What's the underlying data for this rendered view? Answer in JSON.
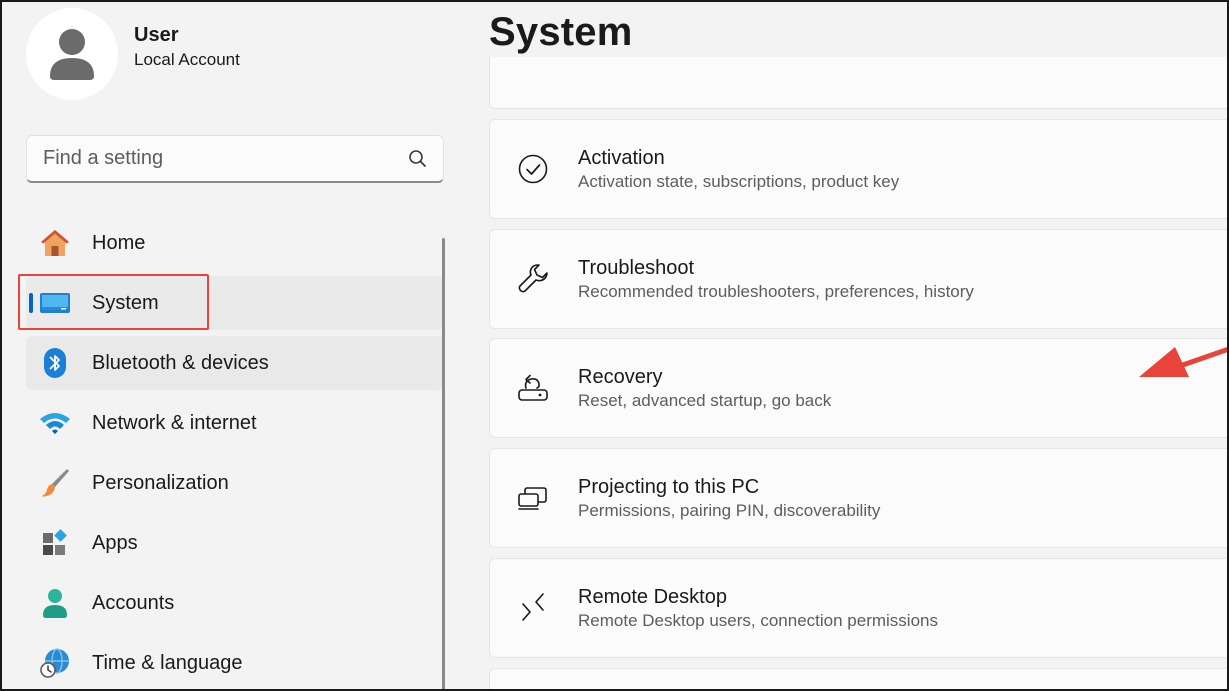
{
  "profile": {
    "name": "User",
    "type": "Local Account"
  },
  "search": {
    "placeholder": "Find a setting"
  },
  "nav": [
    {
      "label": "Home",
      "icon": "home-icon"
    },
    {
      "label": "System",
      "icon": "system-monitor-icon",
      "selected": true
    },
    {
      "label": "Bluetooth & devices",
      "icon": "bluetooth-icon"
    },
    {
      "label": "Network & internet",
      "icon": "wifi-icon"
    },
    {
      "label": "Personalization",
      "icon": "paintbrush-icon"
    },
    {
      "label": "Apps",
      "icon": "apps-icon"
    },
    {
      "label": "Accounts",
      "icon": "accounts-icon"
    },
    {
      "label": "Time & language",
      "icon": "time-language-icon"
    }
  ],
  "main": {
    "title": "System",
    "cards": [
      {
        "title": "Activation",
        "desc": "Activation state, subscriptions, product key",
        "icon": "check-circle-icon"
      },
      {
        "title": "Troubleshoot",
        "desc": "Recommended troubleshooters, preferences, history",
        "icon": "wrench-icon"
      },
      {
        "title": "Recovery",
        "desc": "Reset, advanced startup, go back",
        "icon": "recovery-icon"
      },
      {
        "title": "Projecting to this PC",
        "desc": "Permissions, pairing PIN, discoverability",
        "icon": "projecting-icon"
      },
      {
        "title": "Remote Desktop",
        "desc": "Remote Desktop users, connection permissions",
        "icon": "remote-desktop-icon"
      }
    ]
  },
  "colors": {
    "accent": "#0067c0",
    "annotation": "#e8443a"
  }
}
